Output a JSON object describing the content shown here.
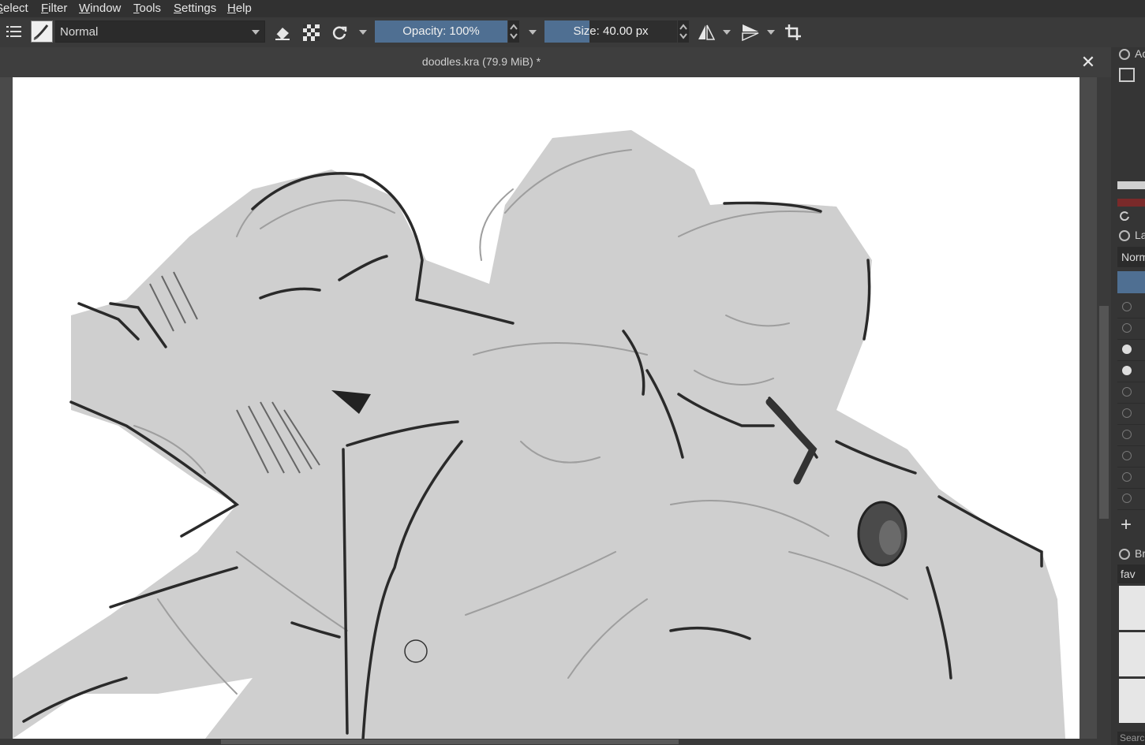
{
  "menu": {
    "items": [
      {
        "label": "elect",
        "acc": "S",
        "key": "select"
      },
      {
        "label": "ilter",
        "acc": "F",
        "key": "filter"
      },
      {
        "label": "indow",
        "acc": "W",
        "key": "window"
      },
      {
        "label": "ools",
        "acc": "T",
        "key": "tools"
      },
      {
        "label": "ettings",
        "acc": "S",
        "key": "settings"
      },
      {
        "label": "elp",
        "acc": "H",
        "key": "help"
      }
    ]
  },
  "toolbar": {
    "blend_mode": "Normal",
    "opacity_label": "Opacity: 100%",
    "opacity_value": 1.0,
    "size_label": "Size: 40.00 px",
    "size_fraction": 0.34,
    "icons": [
      "brush-presets-icon",
      "brush-preview-icon",
      "eraser-icon",
      "alpha-lock-icon",
      "reload-preset-icon",
      "mirror-horizontal-icon",
      "mirror-vertical-icon",
      "wrap-around-icon"
    ]
  },
  "document": {
    "title": "doodles.kra (79.9 MiB) *",
    "close_glyph": "✕"
  },
  "docker": {
    "advanced_color_label": "Ac",
    "layers_label": "La",
    "layer_blend": "Norm",
    "brush_presets_label": "Br",
    "brush_tag": "fav",
    "search_placeholder": "Searc",
    "add_layer_glyph": "+"
  },
  "colors": {
    "accent": "#4f6f92",
    "chrome": "#3a3a3a",
    "canvas": "#ffffff"
  }
}
